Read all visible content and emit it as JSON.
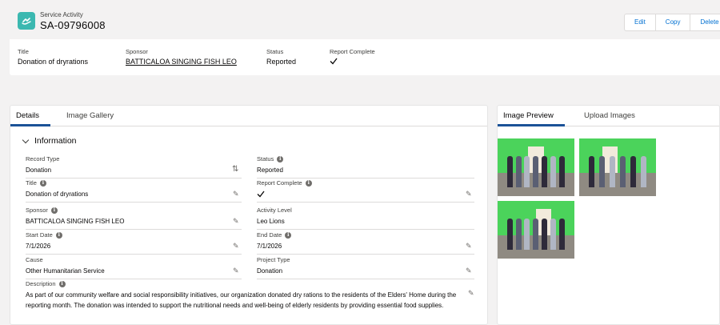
{
  "record": {
    "object_label": "Service Activity",
    "number": "SA-09796008"
  },
  "actions": [
    "Edit",
    "Copy",
    "Delete"
  ],
  "highlights": {
    "title_label": "Title",
    "title_value": "Donation of dryrations",
    "sponsor_label": "Sponsor",
    "sponsor_value": "BATTICALOA SINGING FISH LEO",
    "status_label": "Status",
    "status_value": "Reported",
    "report_label": "Report Complete"
  },
  "left_tabs": [
    "Details",
    "Image Gallery"
  ],
  "section_title": "Information",
  "fields": {
    "record_type": {
      "label": "Record Type",
      "value": "Donation"
    },
    "status": {
      "label": "Status",
      "value": "Reported"
    },
    "title": {
      "label": "Title",
      "value": "Donation of dryrations"
    },
    "report_complete": {
      "label": "Report Complete"
    },
    "sponsor": {
      "label": "Sponsor",
      "value": "BATTICALOA SINGING FISH LEO"
    },
    "activity_level": {
      "label": "Activity Level",
      "value": "Leo Lions"
    },
    "start_date": {
      "label": "Start Date",
      "value": "7/1/2026"
    },
    "end_date": {
      "label": "End Date",
      "value": "7/1/2026"
    },
    "cause": {
      "label": "Cause",
      "value": "Other Humanitarian Service"
    },
    "project_type": {
      "label": "Project Type",
      "value": "Donation"
    },
    "description": {
      "label": "Description",
      "value": "As part of our community welfare and social responsibility initiatives, our organization donated dry rations to the residents of the Elders' Home during the reporting month. The donation was intended to support the nutritional needs and well-being of elderly residents by providing essential food supplies."
    }
  },
  "right_tabs": [
    "Image Preview",
    "Upload Images"
  ],
  "icons": {
    "object": "service-activity-icon",
    "info": "info-icon",
    "edit": "pencil-icon",
    "change": "swap-icon",
    "check": "checkmark-icon",
    "chevron": "chevron-down-icon"
  },
  "colors": {
    "brand": "#1b5297",
    "link": "#006dcc",
    "object_icon": "#3bb8b0"
  }
}
